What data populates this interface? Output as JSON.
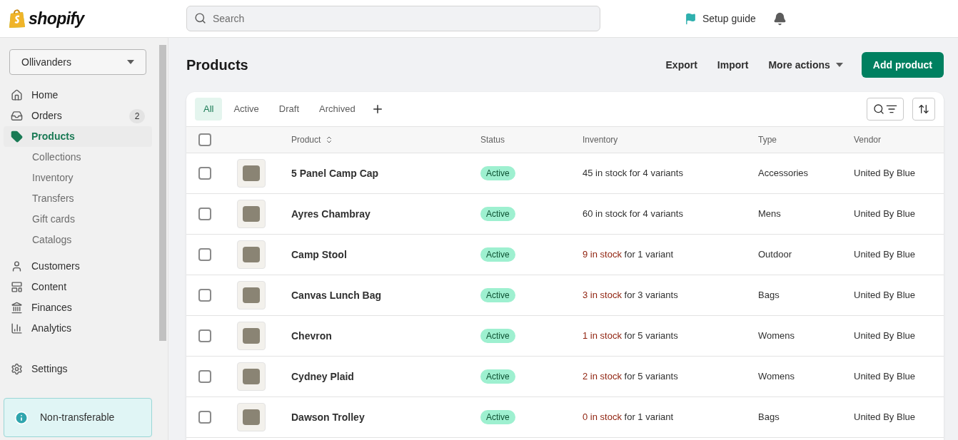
{
  "header": {
    "logo": "shopify",
    "search": {
      "placeholder": "Search"
    },
    "setup_guide": "Setup guide"
  },
  "sidebar": {
    "store": "Ollivanders",
    "items": [
      {
        "label": "Home",
        "selected": false
      },
      {
        "label": "Orders",
        "selected": false,
        "badge": "2"
      },
      {
        "label": "Products",
        "selected": true,
        "children": [
          {
            "label": "Collections"
          },
          {
            "label": "Inventory"
          },
          {
            "label": "Transfers"
          },
          {
            "label": "Gift cards"
          },
          {
            "label": "Catalogs"
          }
        ]
      },
      {
        "label": "Customers",
        "selected": false
      },
      {
        "label": "Content",
        "selected": false
      },
      {
        "label": "Finances",
        "selected": false
      },
      {
        "label": "Analytics",
        "selected": false
      }
    ],
    "settings": "Settings",
    "notice": "Non-transferable"
  },
  "page": {
    "title": "Products",
    "actions": [
      "Export",
      "Import"
    ],
    "more_actions": "More actions",
    "primary": "Add product"
  },
  "tabs": [
    {
      "label": "All",
      "selected": true
    },
    {
      "label": "Active",
      "selected": false
    },
    {
      "label": "Draft",
      "selected": false
    },
    {
      "label": "Archived",
      "selected": false
    }
  ],
  "table": {
    "all_checked": false,
    "columns": [
      "Product",
      "Status",
      "Inventory",
      "Type",
      "Vendor"
    ],
    "rows": [
      {
        "product": "5 Panel Camp Cap",
        "status": "Active",
        "stock": "45 in stock",
        "variants": "for 4 variants",
        "low": false,
        "type": "Accessories",
        "vendor": "United By Blue",
        "checked": false
      },
      {
        "product": "Ayres Chambray",
        "status": "Active",
        "stock": "60 in stock",
        "variants": "for 4 variants",
        "low": false,
        "type": "Mens",
        "vendor": "United By Blue",
        "checked": false
      },
      {
        "product": "Camp Stool",
        "status": "Active",
        "stock": "9 in stock",
        "variants": "for 1 variant",
        "low": true,
        "type": "Outdoor",
        "vendor": "United By Blue",
        "checked": false
      },
      {
        "product": "Canvas Lunch Bag",
        "status": "Active",
        "stock": "3 in stock",
        "variants": "for 3 variants",
        "low": true,
        "type": "Bags",
        "vendor": "United By Blue",
        "checked": false
      },
      {
        "product": "Chevron",
        "status": "Active",
        "stock": "1 in stock",
        "variants": "for 5 variants",
        "low": true,
        "type": "Womens",
        "vendor": "United By Blue",
        "checked": false
      },
      {
        "product": "Cydney Plaid",
        "status": "Active",
        "stock": "2 in stock",
        "variants": "for 5 variants",
        "low": true,
        "type": "Womens",
        "vendor": "United By Blue",
        "checked": false
      },
      {
        "product": "Dawson Trolley",
        "status": "Active",
        "stock": "0 in stock",
        "variants": "for 1 variant",
        "low": true,
        "type": "Bags",
        "vendor": "United By Blue",
        "checked": false
      }
    ]
  }
}
